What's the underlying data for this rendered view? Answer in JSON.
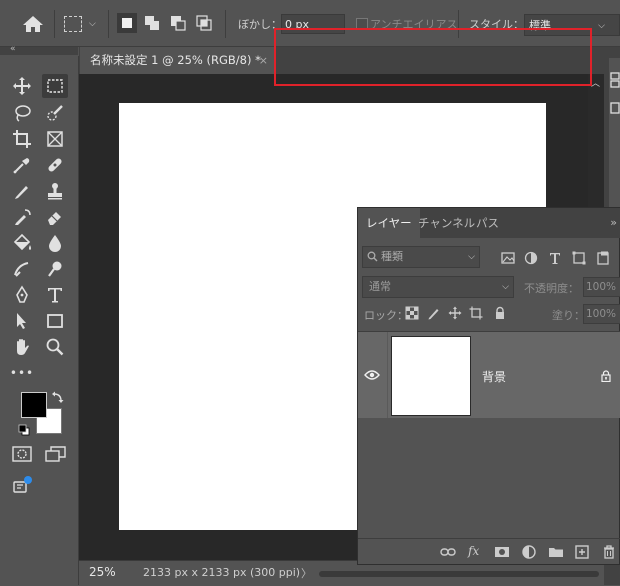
{
  "options_bar": {
    "feather_label": "ぼかし：",
    "feather_value": "0 px",
    "antialias_label": "アンチエイリアス",
    "style_label": "スタイル：",
    "style_value": "標準"
  },
  "document": {
    "tab_title": "名称未設定 1 @ 25% (RGB/8) *",
    "tab_close": "×",
    "zoom": "25%",
    "doc_size": "2133 px x 2133 px (300 ppi)",
    "status_arrow": "〉"
  },
  "colors": {
    "foreground": "#000000",
    "background": "#ffffff",
    "annotation_box": "#e0222a"
  },
  "toolbar": {
    "collapse": "«",
    "tools": [
      "move-icon",
      "marquee-icon",
      "lasso-icon",
      "quick-select-icon",
      "crop-icon",
      "frame-icon",
      "eyedropper-icon",
      "healing-brush-icon",
      "brush-icon",
      "clone-stamp-icon",
      "history-brush-icon",
      "eraser-icon",
      "paint-bucket-icon",
      "blur-icon",
      "dodge-icon",
      "burn-icon",
      "pen-icon",
      "type-icon",
      "path-select-icon",
      "rectangle-icon",
      "hand-icon",
      "zoom-icon",
      "more-tools-icon"
    ],
    "more": "•••"
  },
  "layers_panel": {
    "tabs": [
      "レイヤー",
      "チャンネル",
      "パス"
    ],
    "menu": "»",
    "filter_placeholder": "種類",
    "blend_mode": "通常",
    "opacity_label": "不透明度：",
    "opacity_value": "100%",
    "lock_label": "ロック：",
    "fill_label": "塗り：",
    "fill_value": "100%",
    "layers": [
      {
        "name": "背景",
        "visible": true,
        "locked": true
      }
    ],
    "footer_icons": [
      "link-icon",
      "fx-icon",
      "mask-icon",
      "adjustment-icon",
      "group-folder-icon",
      "new-layer-icon",
      "trash-icon"
    ],
    "fx_label": "fx"
  }
}
